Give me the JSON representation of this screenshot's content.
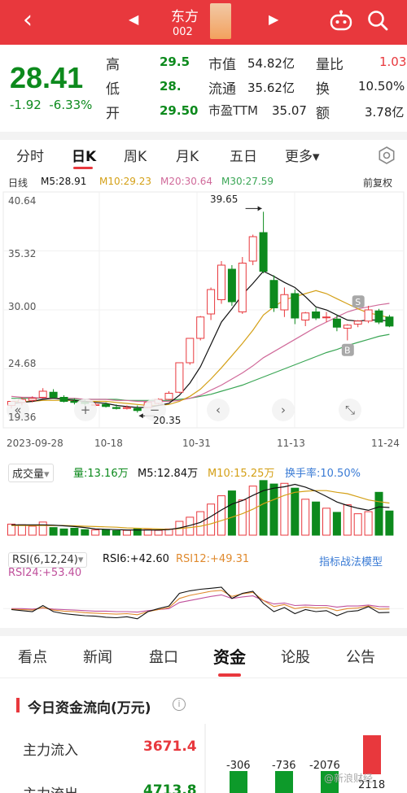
{
  "header": {
    "back_icon": "chevron-left-icon",
    "stock_name": "东方",
    "stock_code": "002",
    "robot_icon": "assistant-robot-icon",
    "search_icon": "search-icon"
  },
  "quote": {
    "price": "28.41",
    "change": "-1.92",
    "change_pct": "-6.33%",
    "high_label": "高",
    "high_val": "29.5",
    "low_label": "低",
    "low_val": "28.",
    "open_label": "开",
    "open_val": "29.50",
    "mktcap_label": "市值",
    "mktcap_val": "54.82亿",
    "float_label": "流通",
    "float_val": "35.62亿",
    "pe_label": "市盈TTM",
    "pe_val": "35.07",
    "vratio_label": "量比",
    "vratio_val": "1.03",
    "turnover_label": "换",
    "turnover_val": "10.50%",
    "amount_label": "额",
    "amount_val": "3.78亿"
  },
  "ktabs": [
    "分时",
    "日K",
    "周K",
    "月K",
    "五日",
    "更多▾"
  ],
  "ma": {
    "label": "日线",
    "m5": "M5:28.91",
    "m10": "M10:29.23",
    "m20": "M20:30.64",
    "m30": "M30:27.59",
    "adjust": "前复权"
  },
  "colors": {
    "up": "#e8383d",
    "down": "#0d8a1d",
    "m5": "#111111",
    "m10": "#d4a017",
    "m20": "#d06a9a",
    "m30": "#3aa655",
    "rsi6": "#111111",
    "rsi12": "#e08a2e",
    "rsi24": "#c0509c"
  },
  "axis": {
    "y_ticks": [
      "40.64",
      "35.32",
      "30.00",
      "24.68",
      "19.36"
    ],
    "high_marker": "39.65",
    "low_marker": "20.35",
    "dates": [
      "2023-09-28",
      "10-18",
      "10-31",
      "11-13",
      "11-24"
    ]
  },
  "chart_data": {
    "type": "candlestick",
    "ylim": [
      19.36,
      40.64
    ],
    "candles": [
      {
        "o": 20.6,
        "h": 21.0,
        "l": 20.3,
        "c": 21.0
      },
      {
        "o": 20.9,
        "h": 21.4,
        "l": 20.6,
        "c": 21.2
      },
      {
        "o": 21.1,
        "h": 21.5,
        "l": 20.9,
        "c": 21.3
      },
      {
        "o": 21.4,
        "h": 22.3,
        "l": 21.3,
        "c": 22.0
      },
      {
        "o": 21.9,
        "h": 22.2,
        "l": 21.3,
        "c": 21.4
      },
      {
        "o": 21.4,
        "h": 21.6,
        "l": 20.9,
        "c": 21.0
      },
      {
        "o": 21.0,
        "h": 21.3,
        "l": 20.7,
        "c": 20.9
      },
      {
        "o": 20.9,
        "h": 21.2,
        "l": 20.6,
        "c": 20.8
      },
      {
        "o": 20.6,
        "h": 20.9,
        "l": 20.5,
        "c": 20.7
      },
      {
        "o": 20.7,
        "h": 20.9,
        "l": 20.4,
        "c": 20.5
      },
      {
        "o": 20.4,
        "h": 20.7,
        "l": 20.2,
        "c": 20.3
      },
      {
        "o": 20.3,
        "h": 20.6,
        "l": 20.2,
        "c": 20.4
      },
      {
        "o": 20.3,
        "h": 20.6,
        "l": 19.9,
        "c": 20.1
      },
      {
        "o": 20.4,
        "h": 21.0,
        "l": 20.4,
        "c": 20.9
      },
      {
        "o": 20.8,
        "h": 21.3,
        "l": 20.7,
        "c": 21.2
      },
      {
        "o": 21.2,
        "h": 22.0,
        "l": 21.1,
        "c": 21.8
      },
      {
        "o": 21.9,
        "h": 24.8,
        "l": 21.8,
        "c": 24.8
      },
      {
        "o": 24.8,
        "h": 27.2,
        "l": 24.6,
        "c": 27.2
      },
      {
        "o": 27.2,
        "h": 29.4,
        "l": 27.0,
        "c": 29.3
      },
      {
        "o": 29.6,
        "h": 32.2,
        "l": 29.0,
        "c": 32.0
      },
      {
        "o": 31.0,
        "h": 34.8,
        "l": 30.6,
        "c": 34.4
      },
      {
        "o": 34.0,
        "h": 34.4,
        "l": 30.4,
        "c": 30.8
      },
      {
        "o": 29.8,
        "h": 35.2,
        "l": 29.6,
        "c": 34.6
      },
      {
        "o": 34.8,
        "h": 37.4,
        "l": 34.4,
        "c": 37.2
      },
      {
        "o": 37.6,
        "h": 39.65,
        "l": 33.6,
        "c": 33.8
      },
      {
        "o": 32.9,
        "h": 33.4,
        "l": 29.8,
        "c": 30.2
      },
      {
        "o": 30.0,
        "h": 32.2,
        "l": 29.3,
        "c": 31.5
      },
      {
        "o": 31.6,
        "h": 32.0,
        "l": 28.6,
        "c": 29.2
      },
      {
        "o": 29.0,
        "h": 29.8,
        "l": 28.4,
        "c": 29.7
      },
      {
        "o": 29.8,
        "h": 30.2,
        "l": 29.0,
        "c": 29.2
      },
      {
        "o": 29.3,
        "h": 29.8,
        "l": 28.8,
        "c": 29.3
      },
      {
        "o": 29.1,
        "h": 29.5,
        "l": 27.9,
        "c": 28.3
      },
      {
        "o": 28.2,
        "h": 28.6,
        "l": 27.0,
        "c": 28.5
      },
      {
        "o": 28.6,
        "h": 29.0,
        "l": 28.3,
        "c": 28.9
      },
      {
        "o": 28.9,
        "h": 30.4,
        "l": 28.7,
        "c": 30.0
      },
      {
        "o": 29.9,
        "h": 30.1,
        "l": 28.6,
        "c": 28.8
      },
      {
        "o": 29.3,
        "h": 29.5,
        "l": 28.3,
        "c": 28.41
      }
    ],
    "ma5": [
      20.8,
      20.9,
      21.0,
      21.2,
      21.3,
      21.2,
      21.1,
      21.0,
      20.9,
      20.8,
      20.6,
      20.5,
      20.4,
      20.4,
      20.6,
      20.8,
      21.6,
      22.8,
      24.4,
      26.6,
      28.8,
      30.1,
      31.5,
      32.6,
      33.8,
      33.3,
      32.7,
      32.2,
      31.3,
      30.3,
      30.0,
      29.5,
      29.0,
      28.9,
      29.0,
      29.0,
      28.91
    ],
    "ma10": [
      21.0,
      21.0,
      21.0,
      21.1,
      21.1,
      21.1,
      21.1,
      21.0,
      21.0,
      21.0,
      20.9,
      20.8,
      20.7,
      20.6,
      20.6,
      20.7,
      21.0,
      21.5,
      22.2,
      23.2,
      24.3,
      25.5,
      26.7,
      28.0,
      29.5,
      30.3,
      31.0,
      31.3,
      31.6,
      31.9,
      31.6,
      31.1,
      30.6,
      30.1,
      29.7,
      29.5,
      29.23
    ],
    "ma20": [
      21.5,
      21.4,
      21.4,
      21.3,
      21.3,
      21.3,
      21.3,
      21.2,
      21.2,
      21.2,
      21.1,
      21.1,
      21.0,
      21.0,
      21.0,
      21.0,
      21.1,
      21.3,
      21.6,
      22.1,
      22.6,
      23.2,
      23.8,
      24.5,
      25.3,
      25.9,
      26.5,
      27.1,
      27.7,
      28.3,
      28.8,
      29.3,
      29.8,
      30.1,
      30.3,
      30.5,
      30.64
    ],
    "ma30": [
      21.3,
      21.3,
      21.3,
      21.3,
      21.3,
      21.3,
      21.2,
      21.2,
      21.2,
      21.2,
      21.2,
      21.1,
      21.1,
      21.1,
      21.1,
      21.1,
      21.2,
      21.3,
      21.5,
      21.7,
      22.0,
      22.3,
      22.6,
      23.0,
      23.4,
      23.8,
      24.2,
      24.6,
      25.0,
      25.4,
      25.8,
      26.1,
      26.5,
      26.8,
      27.1,
      27.4,
      27.59
    ],
    "volume": [
      3.2,
      3.0,
      2.6,
      3.8,
      2.2,
      1.8,
      2.0,
      1.6,
      1.5,
      1.5,
      1.3,
      1.4,
      1.8,
      1.6,
      1.4,
      1.8,
      4.0,
      5.2,
      6.8,
      9.0,
      11.4,
      12.8,
      10.2,
      14.2,
      15.8,
      14.8,
      15.0,
      13.6,
      10.4,
      9.6,
      7.8,
      6.6,
      8.8,
      6.2,
      6.8,
      12.4,
      7.0
    ],
    "vol_ma5": [
      3.0,
      3.0,
      3.0,
      3.0,
      2.9,
      2.7,
      2.5,
      2.2,
      1.8,
      1.7,
      1.6,
      1.5,
      1.5,
      1.5,
      1.5,
      1.6,
      2.1,
      2.8,
      3.7,
      5.4,
      7.3,
      9.0,
      10.0,
      11.5,
      12.9,
      13.6,
      14.0,
      14.7,
      13.9,
      12.7,
      11.2,
      9.6,
      8.6,
      7.8,
      7.2,
      8.2,
      8.0
    ],
    "vol_ma10": [
      2.8,
      2.8,
      2.8,
      2.8,
      2.8,
      2.8,
      2.7,
      2.6,
      2.5,
      2.4,
      2.3,
      2.1,
      2.0,
      1.9,
      1.8,
      1.7,
      1.9,
      2.2,
      2.6,
      3.3,
      4.2,
      5.2,
      6.2,
      7.5,
      9.1,
      10.3,
      11.5,
      12.4,
      12.7,
      12.9,
      12.9,
      12.4,
      12.0,
      11.1,
      10.2,
      9.7,
      9.3
    ],
    "vol_ylim": [
      0,
      16
    ],
    "rsi6": [
      48,
      46,
      44,
      56,
      44,
      40,
      38,
      36,
      35,
      33,
      32,
      34,
      30,
      44,
      50,
      55,
      80,
      85,
      88,
      90,
      92,
      70,
      80,
      84,
      60,
      44,
      52,
      40,
      48,
      44,
      46,
      36,
      44,
      46,
      54,
      42,
      42.6
    ],
    "rsi12": [
      49,
      48,
      47,
      52,
      47,
      45,
      44,
      42,
      41,
      40,
      39,
      40,
      38,
      44,
      48,
      52,
      70,
      76,
      80,
      84,
      86,
      74,
      79,
      82,
      66,
      54,
      58,
      50,
      53,
      51,
      52,
      46,
      50,
      51,
      55,
      49,
      49.3
    ],
    "rsi24": [
      50,
      50,
      49,
      51,
      49,
      48,
      47,
      46,
      45,
      45,
      44,
      44,
      43,
      46,
      48,
      50,
      62,
      66,
      70,
      74,
      77,
      70,
      73,
      75,
      66,
      59,
      61,
      56,
      57,
      56,
      56,
      53,
      55,
      55,
      57,
      54,
      53.4
    ],
    "rsi_ylim": [
      20,
      100
    ]
  },
  "volume_panel": {
    "label": "成交量",
    "dropdown": "▾",
    "vol": "量:13.16万",
    "m5": "M5:12.84万",
    "m10": "M10:15.25万",
    "turnover": "换手率:10.50%"
  },
  "rsi_panel": {
    "label": "RSI(6,12,24)",
    "dropdown": "▾",
    "rsi6": "RSI6:+42.60",
    "rsi12": "RSI12:+49.31",
    "rsi24": "RSI24:+53.40",
    "model_link": "指标战法模型"
  },
  "bottom_tabs": [
    "看点",
    "新闻",
    "盘口",
    "资金",
    "论股",
    "公告"
  ],
  "flow": {
    "title": "今日资金流向(万元)",
    "info_icon": "info-icon",
    "rows": [
      {
        "label": "主力流入",
        "value": "3671.4"
      },
      {
        "label": "主力流出",
        "value": "4713.8"
      }
    ],
    "bars": [
      "-306",
      "-736",
      "-2076",
      "2118"
    ]
  },
  "watermark": "@新浪财经"
}
